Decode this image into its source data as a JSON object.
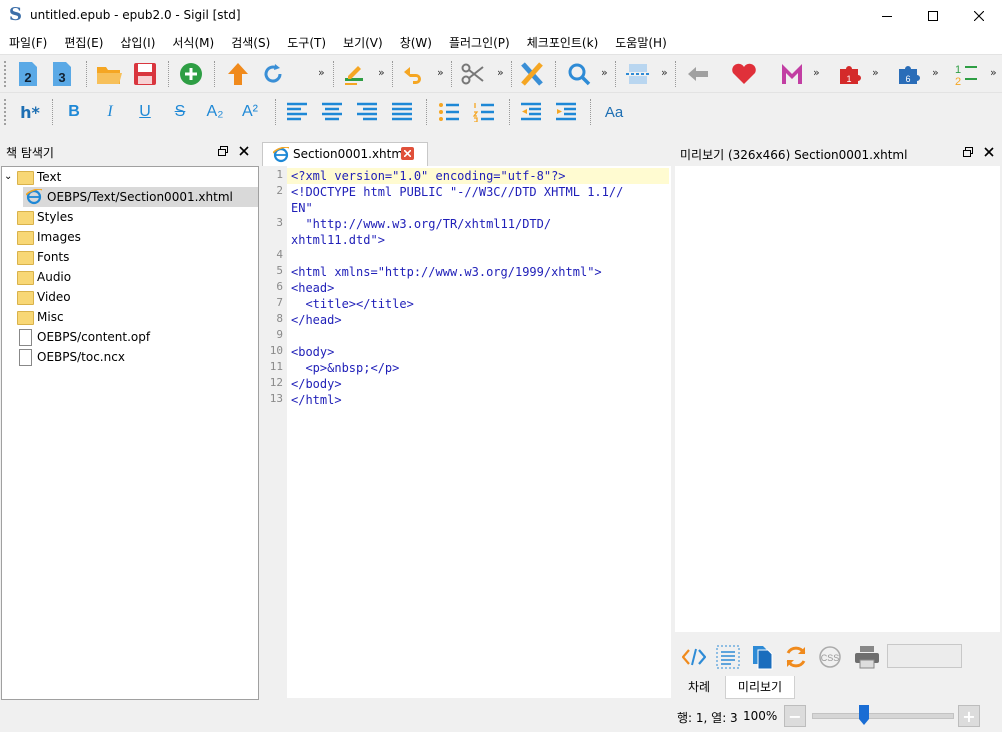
{
  "window": {
    "title": "untitled.epub - epub2.0 - Sigil [std]",
    "app_icon_glyph": "S",
    "min_glyph": "—",
    "max_glyph": "☐",
    "close_glyph": "✕"
  },
  "menu": [
    "파일(F)",
    "편집(E)",
    "삽입(I)",
    "서식(M)",
    "검색(S)",
    "도구(T)",
    "보기(V)",
    "창(W)",
    "플러그인(P)",
    "체크포인트(k)",
    "도움말(H)"
  ],
  "toolbar2": {
    "heading_label": "h*",
    "bold": "B",
    "italic": "I",
    "underline": "U",
    "strike": "S",
    "sub": "A₂",
    "sup": "A²",
    "case_label": "Aa"
  },
  "book_browser": {
    "title": "책 탐색기",
    "items": [
      {
        "label": "Text",
        "kind": "folder"
      },
      {
        "label": "OEBPS/Text/Section0001.xhtml",
        "kind": "xhtml"
      },
      {
        "label": "Styles",
        "kind": "folder"
      },
      {
        "label": "Images",
        "kind": "folder"
      },
      {
        "label": "Fonts",
        "kind": "folder"
      },
      {
        "label": "Audio",
        "kind": "folder"
      },
      {
        "label": "Video",
        "kind": "folder"
      },
      {
        "label": "Misc",
        "kind": "folder"
      },
      {
        "label": "OEBPS/content.opf",
        "kind": "file"
      },
      {
        "label": "OEBPS/toc.ncx",
        "kind": "file"
      }
    ]
  },
  "editor": {
    "tab_label": "Section0001.xhtml",
    "line_numbers": [
      "1",
      "2",
      "",
      "3",
      "",
      "4",
      "5",
      "6",
      "7",
      "8",
      "9",
      "10",
      "11",
      "12",
      "13"
    ],
    "lines": [
      "<?xml version=\"1.0\" encoding=\"utf-8\"?>",
      "<!DOCTYPE html PUBLIC \"-//W3C//DTD XHTML 1.1//",
      "EN\"",
      "  \"http://www.w3.org/TR/xhtml11/DTD/",
      "xhtml11.dtd\">",
      "",
      "<html xmlns=\"http://www.w3.org/1999/xhtml\">",
      "<head>",
      "  <title></title>",
      "</head>",
      "",
      "<body>",
      "  <p>&nbsp;</p>",
      "</body>",
      "</html>"
    ]
  },
  "preview": {
    "title": "미리보기 (326x466) Section0001.xhtml",
    "tabs": [
      "차례",
      "미리보기"
    ]
  },
  "status": {
    "position": "행: 1, 열: 3",
    "zoom": "100%",
    "zoom_fraction": 0.35,
    "minus": "−",
    "plus": "+"
  }
}
